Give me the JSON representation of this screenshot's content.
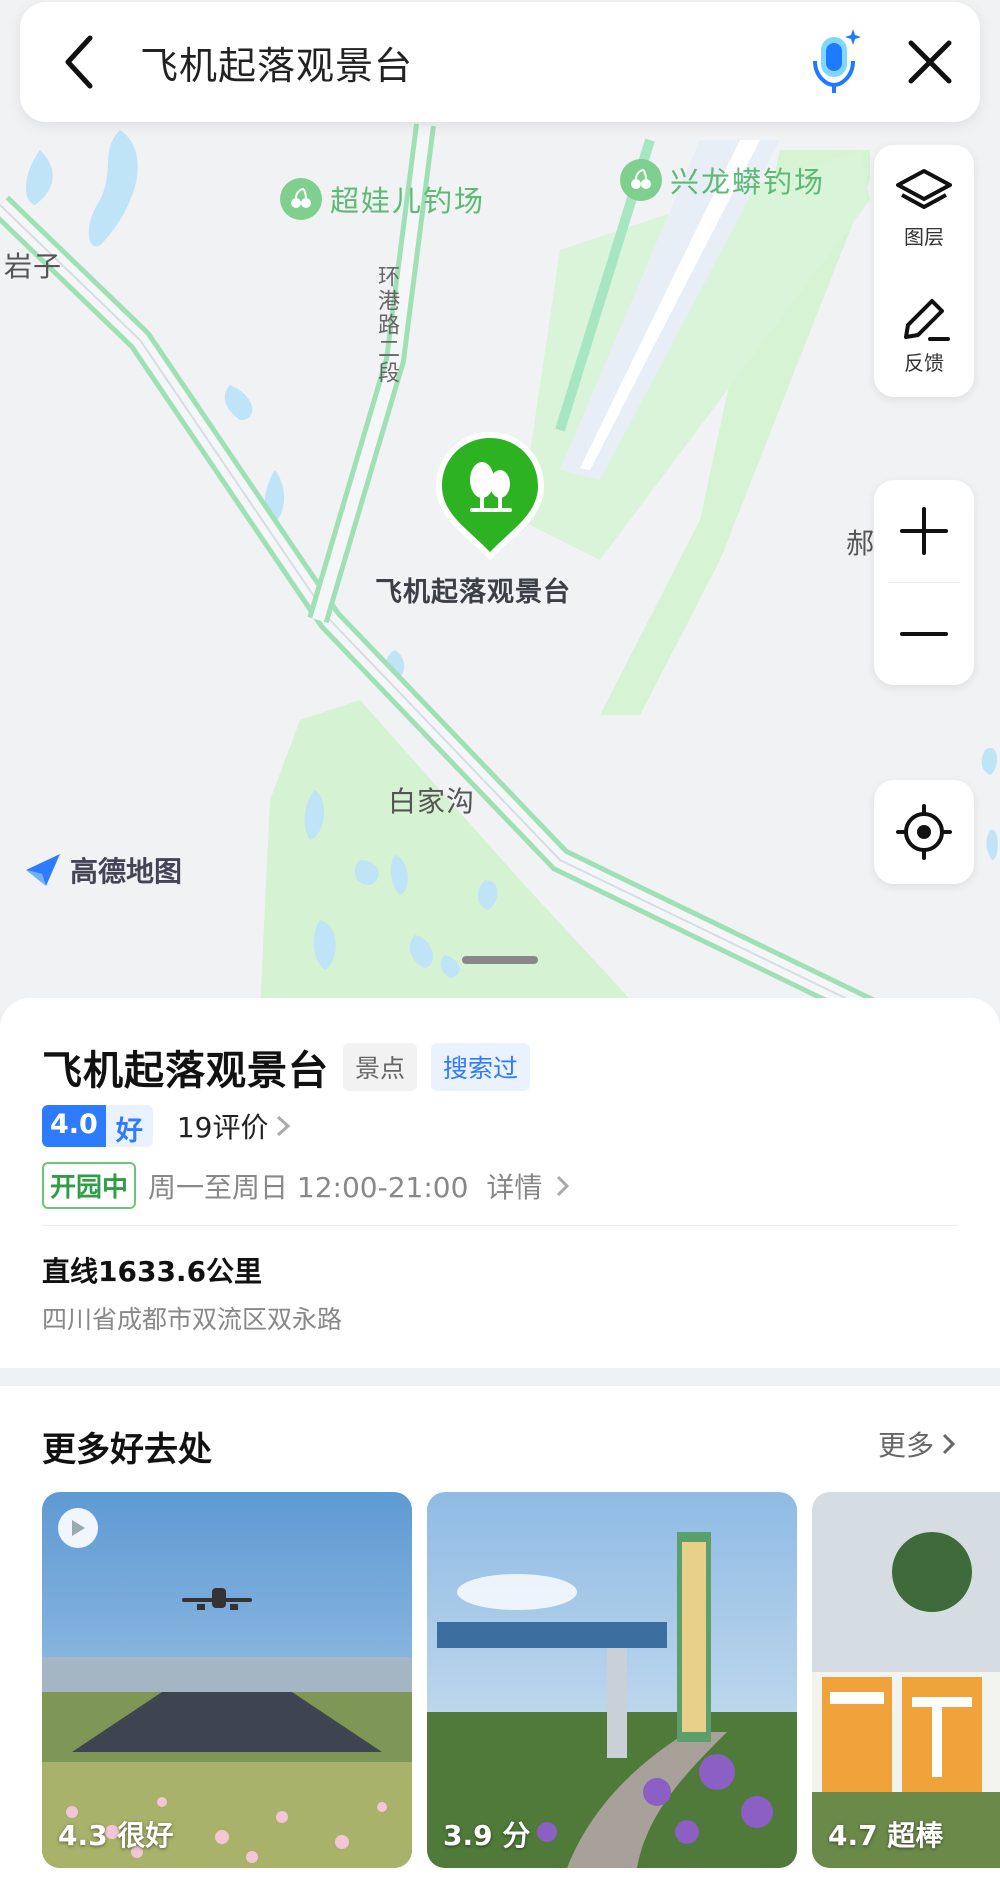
{
  "search": {
    "query": "飞机起落观景台"
  },
  "map": {
    "labels": {
      "yanzi": "岩子",
      "huangang_road": "环港路二段",
      "baijiagou": "白家沟",
      "partial_right": "郝"
    },
    "pois": {
      "chaowaer": "超娃儿钓场",
      "xinglong": "兴龙蟒钓场"
    },
    "marker_label": "飞机起落观景台",
    "logo_text": "高德地图",
    "controls": {
      "layers_label": "图层",
      "feedback_label": "反馈"
    }
  },
  "place": {
    "name": "飞机起落观景台",
    "category_tag": "景点",
    "searched_tag": "搜索过",
    "score": "4.0",
    "score_level": "好",
    "reviews": "19评价",
    "open_status": "开园中",
    "hours": "周一至周日 12:00-21:00",
    "details": "详情",
    "distance": "直线1633.6公里",
    "address": "四川省成都市双流区双永路"
  },
  "more": {
    "title": "更多好去处",
    "link": "更多",
    "cards": [
      {
        "score_text": "4.3 很好"
      },
      {
        "score_text": "3.9 分"
      },
      {
        "score_text": "4.7 超棒"
      }
    ]
  },
  "colors": {
    "accent_blue": "#2f7bff",
    "marker_green": "#2db322",
    "road_green": "#9fe0b7",
    "open_green": "#2f9e44"
  }
}
